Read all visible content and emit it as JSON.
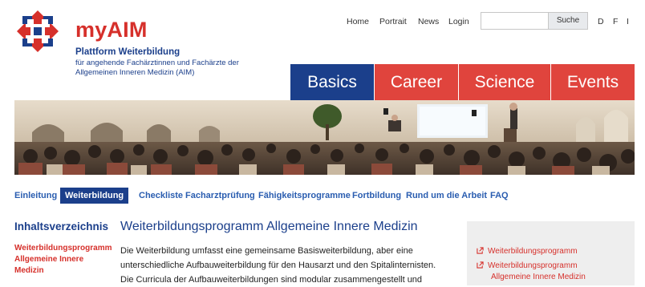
{
  "brand": {
    "title": "myAIM",
    "subtitle": "Plattform Weiterbildung",
    "description": "für angehende Fachärztinnen und Fachärzte der Allgemeinen Inneren Medizin (AIM)"
  },
  "topnav": {
    "items": [
      "Home",
      "Portrait",
      "News",
      "Login"
    ],
    "search_button": "Suche",
    "search_placeholder": "",
    "languages": [
      "D",
      "F",
      "I"
    ]
  },
  "mainnav": {
    "tabs": [
      {
        "label": "Basics",
        "active": true
      },
      {
        "label": "Career",
        "active": false
      },
      {
        "label": "Science",
        "active": false
      },
      {
        "label": "Events",
        "active": false
      }
    ]
  },
  "subnav": {
    "items": [
      {
        "label": "Einleitung",
        "active": false
      },
      {
        "label": "Weiterbildung",
        "active": true
      },
      {
        "label": "Checkliste",
        "active": false
      },
      {
        "label": "Facharztprüfung",
        "active": false
      },
      {
        "label": "Fähigkeitsprogramme",
        "active": false
      },
      {
        "label": "Fortbildung",
        "active": false
      },
      {
        "label": "Rund um die Arbeit",
        "active": false
      },
      {
        "label": "FAQ",
        "active": false
      }
    ]
  },
  "toc": {
    "title": "Inhaltsverzeichnis",
    "item_line1": "Weiterbildungsprogramm",
    "item_rest": "Allgemeine Innere Medizin"
  },
  "article": {
    "title": "Weiterbildungsprogramm Allgemeine Innere Medizin",
    "line1": "Die Weiterbildung umfasst eine gemeinsame Basisweiterbildung, aber eine",
    "line2": "unterschiedliche Aufbauweiterbildung für den Hausarzt und den Spitalinternisten.",
    "line3": "Die Curricula der Aufbauweiterbildungen sind modular zusammengestellt und"
  },
  "sidebar": {
    "links": [
      "Weiterbildungsprogramm",
      "Weiterbildungsprogramm",
      "Allgemeine Innere Medizin"
    ]
  },
  "colors": {
    "brand_red": "#d6302b",
    "brand_blue": "#1b3f8b",
    "link_blue": "#2a5db0",
    "tab_red": "#e0443d",
    "tab_blue": "#1b3f8b"
  }
}
